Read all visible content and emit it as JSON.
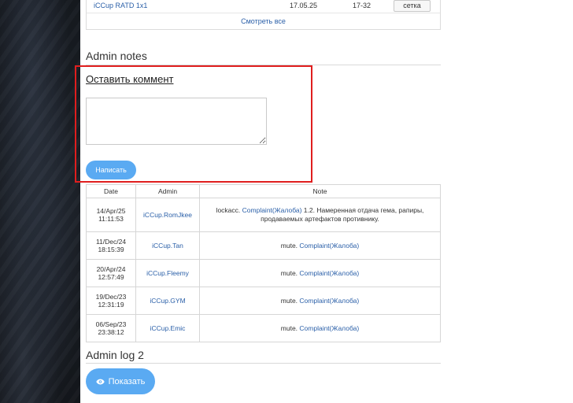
{
  "top_table": {
    "row": {
      "name": "iCCup RATD 1x1",
      "date": "17.05.25",
      "range": "17-32",
      "button": "сетка"
    },
    "see_all": "Смотреть все"
  },
  "admin_notes": {
    "title": "Admin notes",
    "comment_link": "Оставить коммент",
    "comment_value": "",
    "write_button": "Написать",
    "headers": {
      "date": "Date",
      "admin": "Admin",
      "note": "Note"
    },
    "rows": [
      {
        "date": "14/Apr/25",
        "time": "11:11:53",
        "admin": "iCCup.RomJkee",
        "prefix": "lockacc. ",
        "link": "Complaint(Жалоба)",
        "suffix": " 1.2. Намеренная отдача гема, рапиры, продаваемых артефактов противнику."
      },
      {
        "date": "11/Dec/24",
        "time": "18:15:39",
        "admin": "iCCup.Tan",
        "prefix": "mute. ",
        "link": "Complaint(Жалоба)",
        "suffix": ""
      },
      {
        "date": "20/Apr/24",
        "time": "12:57:49",
        "admin": "iCCup.Fleemy",
        "prefix": "mute. ",
        "link": "Complaint(Жалоба)",
        "suffix": ""
      },
      {
        "date": "19/Dec/23",
        "time": "12:31:19",
        "admin": "iCCup.GYM",
        "prefix": "mute. ",
        "link": "Complaint(Жалоба)",
        "suffix": ""
      },
      {
        "date": "06/Sep/23",
        "time": "23:38:12",
        "admin": "iCCup.Emic",
        "prefix": "mute. ",
        "link": "Complaint(Жалоба)",
        "suffix": ""
      }
    ]
  },
  "admin_log": {
    "title": "Admin log 2",
    "show_button": "Показать",
    "show_icon": "eye-icon"
  },
  "colors": {
    "accent": "#5aaaf2",
    "link": "#2a5fa8",
    "highlight": "#e01e1e"
  }
}
